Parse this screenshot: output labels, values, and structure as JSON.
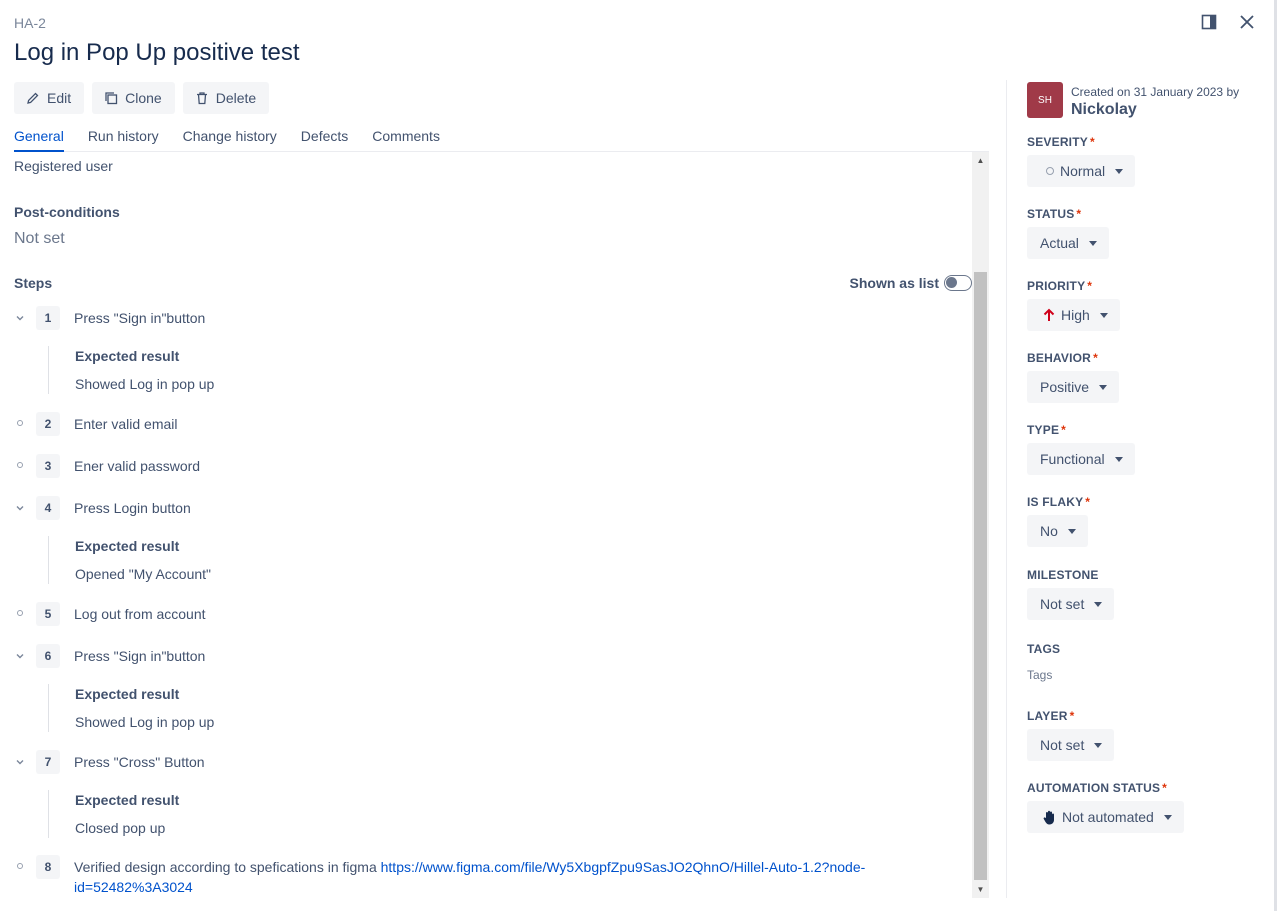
{
  "case": {
    "key": "HA-2",
    "title": "Log in Pop Up positive test"
  },
  "toolbar": {
    "edit": "Edit",
    "clone": "Clone",
    "delete": "Delete"
  },
  "tabs": [
    "General",
    "Run history",
    "Change history",
    "Defects",
    "Comments"
  ],
  "general": {
    "precondition_value": "Registered user",
    "postconditions_label": "Post-conditions",
    "postconditions_value": "Not set",
    "steps_label": "Steps",
    "shown_as_list": "Shown as list",
    "expected_label": "Expected result"
  },
  "steps": [
    {
      "num": "1",
      "action": "Press \"Sign in\"button",
      "expected": "Showed Log in pop up"
    },
    {
      "num": "2",
      "action": "Enter valid email"
    },
    {
      "num": "3",
      "action": "Ener valid password"
    },
    {
      "num": "4",
      "action": "Press Login button",
      "expected": "Opened \"My Account\""
    },
    {
      "num": "5",
      "action": "Log out from account"
    },
    {
      "num": "6",
      "action": "Press \"Sign in\"button",
      "expected": "Showed Log in pop up"
    },
    {
      "num": "7",
      "action": "Press \"Cross\" Button",
      "expected": "Closed pop up"
    },
    {
      "num": "8",
      "action": "Verified design according to spefications in figma ",
      "link": "https://www.figma.com/file/Wy5XbgpfZpu9SasJO2QhnO/Hillel-Auto-1.2?node-id=52482%3A3024"
    }
  ],
  "sidebar": {
    "avatar": "SH",
    "created": "Created on 31 January 2023 by",
    "author": "Nickolay",
    "fields": {
      "severity": {
        "label": "SEVERITY",
        "value": "Normal"
      },
      "status": {
        "label": "STATUS",
        "value": "Actual"
      },
      "priority": {
        "label": "PRIORITY",
        "value": "High"
      },
      "behavior": {
        "label": "BEHAVIOR",
        "value": "Positive"
      },
      "type": {
        "label": "TYPE",
        "value": "Functional"
      },
      "is_flaky": {
        "label": "IS FLAKY",
        "value": "No"
      },
      "milestone": {
        "label": "MILESTONE",
        "value": "Not set"
      },
      "tags": {
        "label": "TAGS",
        "value": "Tags"
      },
      "layer": {
        "label": "LAYER",
        "value": "Not set"
      },
      "automation_status": {
        "label": "AUTOMATION STATUS",
        "value": "Not automated"
      }
    },
    "required_mark": "*"
  },
  "colors": {
    "accent": "#0052cc",
    "required": "#de350b",
    "priority_high": "#d0021b",
    "avatar": "#a03a48"
  },
  "icons": [
    "panel-icon",
    "close-icon",
    "pencil-icon",
    "copy-icon",
    "trash-icon",
    "chevron-down-icon",
    "bullet-dot-icon",
    "arrow-up-icon",
    "hand-icon"
  ]
}
